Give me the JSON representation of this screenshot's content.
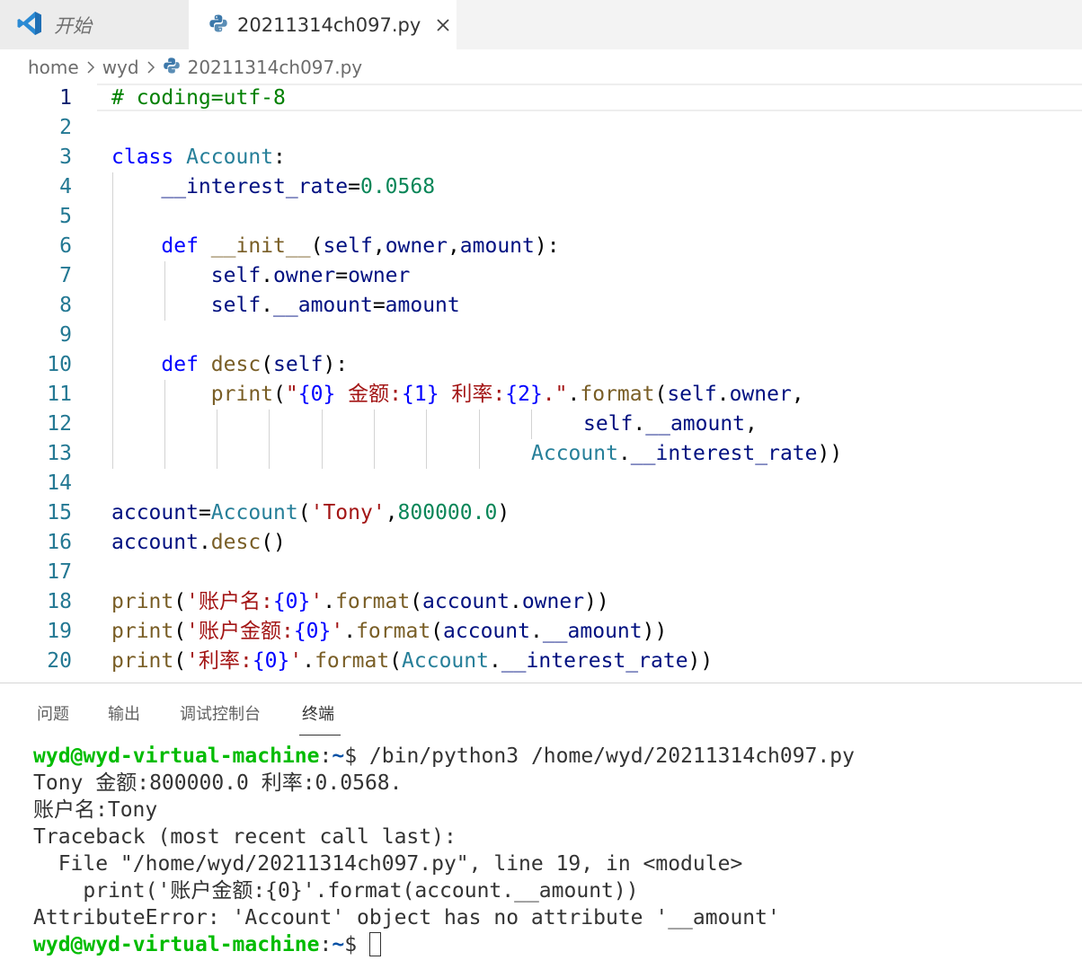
{
  "tabs": [
    {
      "label": "开始",
      "icon": "vscode-logo-icon"
    },
    {
      "label": "20211314ch097.py",
      "icon": "python-icon",
      "close_icon": "close-icon"
    }
  ],
  "breadcrumb": {
    "items": [
      "home",
      "wyd",
      "20211314ch097.py"
    ]
  },
  "editor": {
    "line_numbers": [
      "1",
      "2",
      "3",
      "4",
      "5",
      "6",
      "7",
      "8",
      "9",
      "10",
      "11",
      "12",
      "13",
      "14",
      "15",
      "16",
      "17",
      "18",
      "19",
      "20"
    ],
    "t": {
      "l1": "# coding=utf-8",
      "l3a": "class",
      "l3b": "Account",
      "l3c": ":",
      "l4a": "__interest_rate",
      "l4b": "=",
      "l4c": "0.0568",
      "l6a": "def",
      "l6b": "__init__",
      "l6c": "(",
      "l6d": "self",
      "l6e": ",",
      "l6f": "owner",
      "l6g": ",",
      "l6h": "amount",
      "l6i": "):",
      "l7a": "self",
      "l7b": ".",
      "l7c": "owner",
      "l7d": "=",
      "l7e": "owner",
      "l8a": "self",
      "l8b": ".",
      "l8c": "__amount",
      "l8d": "=",
      "l8e": "amount",
      "l10a": "def",
      "l10b": "desc",
      "l10c": "(",
      "l10d": "self",
      "l10e": "):",
      "l11a": "print",
      "l11b": "(",
      "l11c": "\"",
      "l11d": "{0}",
      "l11e": " 金额:",
      "l11f": "{1}",
      "l11g": " 利率:",
      "l11h": "{2}",
      "l11i": ".\"",
      "l11j": ".",
      "l11k": "format",
      "l11l": "(",
      "l11m": "self",
      "l11n": ".",
      "l11o": "owner",
      "l11p": ",",
      "l12a": "self",
      "l12b": ".",
      "l12c": "__amount",
      "l12d": ",",
      "l13a": "Account",
      "l13b": ".",
      "l13c": "__interest_rate",
      "l13d": "))",
      "l15a": "account",
      "l15b": "=",
      "l15c": "Account",
      "l15d": "(",
      "l15e": "'Tony'",
      "l15f": ",",
      "l15g": "800000.0",
      "l15h": ")",
      "l16a": "account",
      "l16b": ".",
      "l16c": "desc",
      "l16d": "()",
      "l18a": "print",
      "l18b": "(",
      "l18c": "'账户名:",
      "l18d": "{0}",
      "l18e": "'",
      "l18f": ".",
      "l18g": "format",
      "l18h": "(",
      "l18i": "account",
      "l18j": ".",
      "l18k": "owner",
      "l18l": "))",
      "l19a": "print",
      "l19b": "(",
      "l19c": "'账户金额:",
      "l19d": "{0}",
      "l19e": "'",
      "l19f": ".",
      "l19g": "format",
      "l19h": "(",
      "l19i": "account",
      "l19j": ".",
      "l19k": "__amount",
      "l19l": "))",
      "l20a": "print",
      "l20b": "(",
      "l20c": "'利率:",
      "l20d": "{0}",
      "l20e": "'",
      "l20f": ".",
      "l20g": "format",
      "l20h": "(",
      "l20i": "Account",
      "l20j": ".",
      "l20k": "__interest_rate",
      "l20l": "))"
    }
  },
  "panel": {
    "tabs": [
      "问题",
      "输出",
      "调试控制台",
      "终端"
    ],
    "active_tab": "终端"
  },
  "terminal": {
    "prompt_user": "wyd@wyd-virtual-machine",
    "prompt_sep": ":",
    "prompt_path": "~",
    "prompt_symbol": "$",
    "command": " /bin/python3 /home/wyd/20211314ch097.py",
    "output": [
      "Tony 金额:800000.0 利率:0.0568.",
      "账户名:Tony",
      "Traceback (most recent call last):",
      "  File \"/home/wyd/20211314ch097.py\", line 19, in <module>",
      "    print('账户金额:{0}'.format(account.__amount))",
      "AttributeError: 'Account' object has no attribute '__amount'"
    ]
  },
  "colors": {
    "keyword": "#0000ff",
    "class": "#267f99",
    "variable": "#001080",
    "number": "#098658",
    "function": "#795e26",
    "string": "#a31515",
    "comment": "#008000",
    "terminal_user": "#00bc00"
  }
}
